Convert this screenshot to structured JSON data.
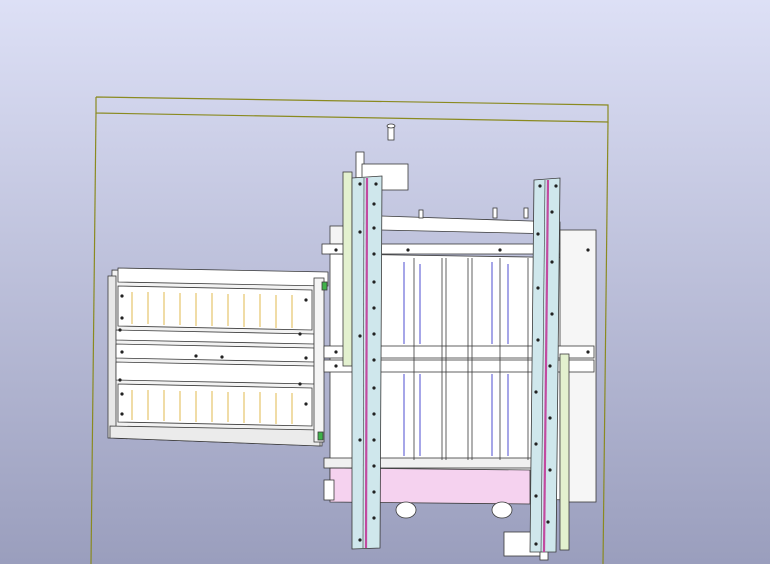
{
  "viewport": {
    "background_top": "#dde0f6",
    "background_bottom": "#9a9ebd",
    "bounding_box_color": "#8a8a20"
  },
  "model": {
    "part_fill": "#ffffff",
    "edge_color": "#3a3a3a",
    "rail_fill": "#cfe7ec",
    "rail_accent_color": "#c24aa0",
    "pink_panel_fill": "#f5d2ef",
    "green_bar_fill": "#e3f1cf",
    "green_accent_color": "#3fb24a",
    "blue_rod_color": "#6a6ad8",
    "yellow_slat_color": "#e6c46a"
  }
}
